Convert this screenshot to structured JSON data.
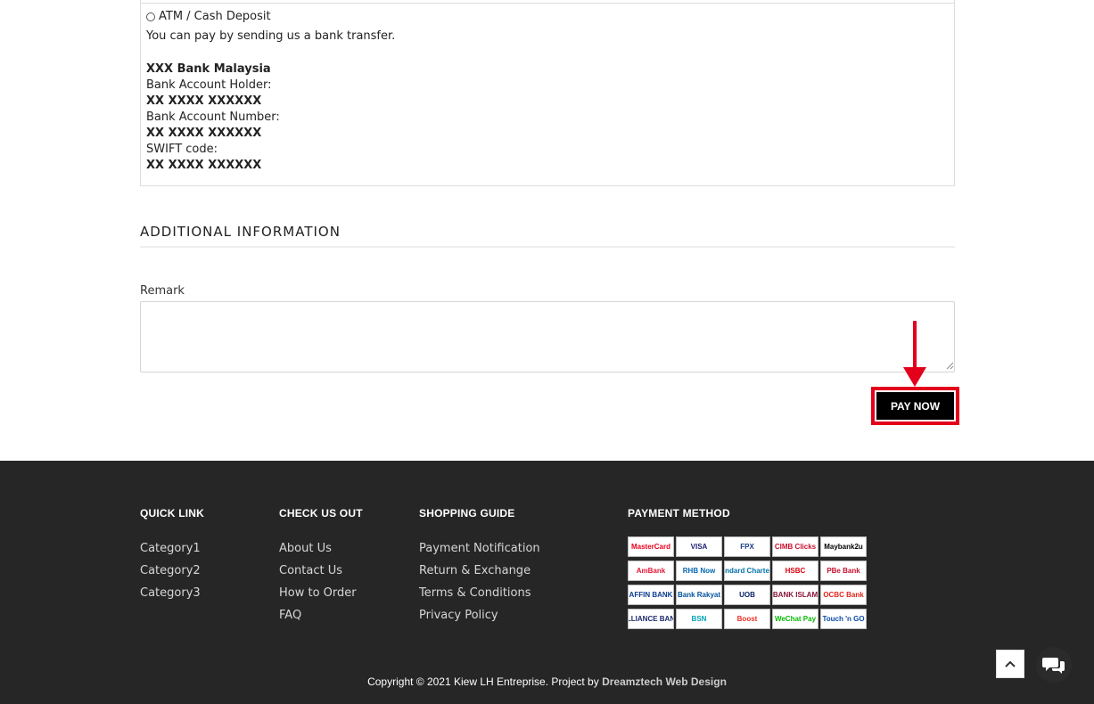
{
  "payment": {
    "option_label": "ATM / Cash Deposit",
    "description": "You can pay by sending us a bank transfer.",
    "bank_name": "XXX Bank Malaysia",
    "holder_label": "Bank Account Holder:",
    "holder_value": "XX XXXX XXXXXX",
    "number_label": "Bank Account Number:",
    "number_value": "XX XXXX XXXXXX",
    "swift_label": "SWIFT code:",
    "swift_value": "XX XXXX XXXXXX"
  },
  "additional": {
    "title": "ADDITIONAL INFORMATION",
    "remark_label": "Remark",
    "remark_value": ""
  },
  "pay_button": {
    "label": "PAY NOW"
  },
  "highlight_color": "#e3001b",
  "footer": {
    "quick_link": {
      "title": "QUICK LINK",
      "items": [
        "Category1",
        "Category2",
        "Category3"
      ]
    },
    "check_us_out": {
      "title": "CHECK US OUT",
      "items": [
        "About Us",
        "Contact Us",
        "How to Order",
        "FAQ"
      ]
    },
    "shopping_guide": {
      "title": "SHOPPING GUIDE",
      "items": [
        "Payment Notification",
        "Return & Exchange",
        "Terms & Conditions",
        "Privacy Policy"
      ]
    },
    "payment_method": {
      "title": "PAYMENT METHOD",
      "logos": [
        {
          "label": "MasterCard",
          "color": "#eb001b"
        },
        {
          "label": "VISA",
          "color": "#1a1f71"
        },
        {
          "label": "FPX",
          "color": "#1a3c8c"
        },
        {
          "label": "CIMB Clicks",
          "color": "#c8102e"
        },
        {
          "label": "Maybank2u",
          "color": "#000000"
        },
        {
          "label": "AmBank",
          "color": "#e31837"
        },
        {
          "label": "RHB Now",
          "color": "#0067b1"
        },
        {
          "label": "Standard Chartered",
          "color": "#0072aa"
        },
        {
          "label": "HSBC",
          "color": "#db0011"
        },
        {
          "label": "PBe Bank",
          "color": "#c8102e"
        },
        {
          "label": "AFFIN BANK",
          "color": "#0a3d91"
        },
        {
          "label": "Bank Rakyat",
          "color": "#00529b"
        },
        {
          "label": "UOB",
          "color": "#0b2265"
        },
        {
          "label": "BANK ISLAM",
          "color": "#8a1538"
        },
        {
          "label": "OCBC Bank",
          "color": "#e2231a"
        },
        {
          "label": "ALLIANCE BANK",
          "color": "#1c2a6b"
        },
        {
          "label": "BSN",
          "color": "#00a3b4"
        },
        {
          "label": "Boost",
          "color": "#ee2e24"
        },
        {
          "label": "WeChat Pay",
          "color": "#09bb07"
        },
        {
          "label": "Touch 'n GO",
          "color": "#0a4aa5"
        }
      ]
    },
    "copyright_prefix": "Copyright © 2021 Kiew LH Entreprise. Project by",
    "copyright_link": "Dreamztech Web Design"
  }
}
